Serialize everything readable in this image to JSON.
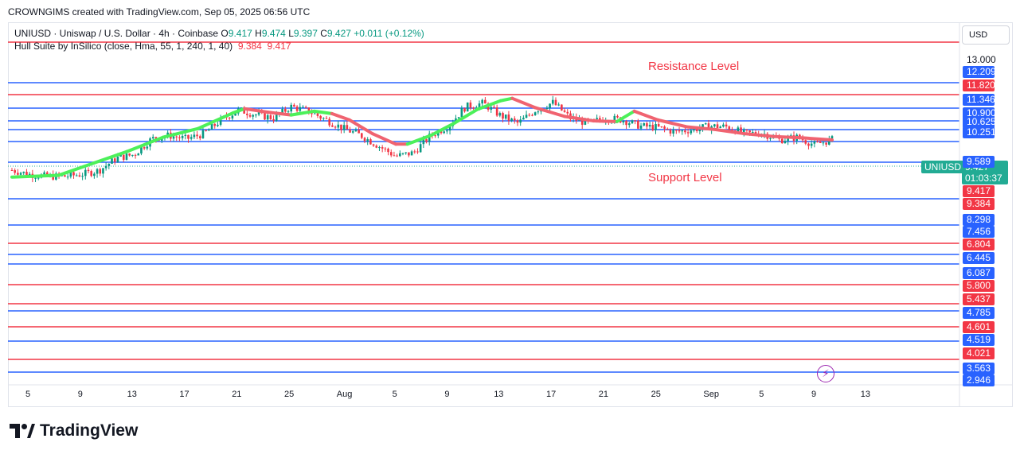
{
  "header": {
    "caption": "CROWNGIMS created with TradingView.com, Sep 05, 2025 06:56 UTC"
  },
  "legend": {
    "symbol_line": "UNIUSD · Uniswap / U.S. Dollar · 4h · Coinbase",
    "o_label": "O",
    "o_value": "9.417",
    "h_label": "H",
    "h_value": "9.474",
    "l_label": "L",
    "l_value": "9.397",
    "c_label": "C",
    "c_value": "9.427",
    "change": "+0.011 (+0.12%)",
    "indicator_line": "Hull Suite by InSilico (close, Hma, 55, 1, 240, 1, 40)",
    "ind_value_1": "9.384",
    "ind_value_2": "9.417"
  },
  "currency_button": "USD",
  "annotations": {
    "resistance": "Resistance Level",
    "support": "Support Level"
  },
  "symbol_tag": "UNIUSD",
  "last_price": {
    "value": "9.427",
    "countdown": "01:03:37"
  },
  "branding": {
    "logo_text": "TradingView"
  },
  "colors": {
    "up": "#089981",
    "down": "#f23645",
    "blue_level": "#2962ff",
    "red_level": "#f23645",
    "hull_up": "#4cf05a",
    "hull_down": "#f06370"
  },
  "chart_data": {
    "type": "candlestick",
    "ylim": [
      2.946,
      13.0
    ],
    "top_tick": "13.000",
    "price_levels": [
      {
        "value": 12.209,
        "label": "12.209",
        "color": "blue"
      },
      {
        "value": 11.82,
        "label": "11.820",
        "color": "red"
      },
      {
        "value": 11.346,
        "label": "11.346",
        "color": "blue"
      },
      {
        "value": 10.9,
        "label": "10.900",
        "color": "blue"
      },
      {
        "value": 10.625,
        "label": "10.625",
        "color": "blue"
      },
      {
        "value": 10.251,
        "label": "10.251",
        "color": "blue"
      },
      {
        "value": 9.589,
        "label": "9.589",
        "color": "blue"
      },
      {
        "value": 9.417,
        "label": "9.417",
        "color": "red-badge"
      },
      {
        "value": 9.384,
        "label": "9.384",
        "color": "red-badge"
      },
      {
        "value": 8.298,
        "label": "8.298",
        "color": "blue"
      },
      {
        "value": 7.456,
        "label": "7.456",
        "color": "blue"
      },
      {
        "value": 6.804,
        "label": "6.804",
        "color": "red"
      },
      {
        "value": 6.445,
        "label": "6.445",
        "color": "blue"
      },
      {
        "value": 6.087,
        "label": "6.087",
        "color": "blue"
      },
      {
        "value": 5.8,
        "label": "5.800",
        "color": "red"
      },
      {
        "value": 5.437,
        "label": "5.437",
        "color": "red"
      },
      {
        "value": 4.785,
        "label": "4.785",
        "color": "blue"
      },
      {
        "value": 4.601,
        "label": "4.601",
        "color": "red"
      },
      {
        "value": 4.519,
        "label": "4.519",
        "color": "blue"
      },
      {
        "value": 4.021,
        "label": "4.021",
        "color": "red"
      },
      {
        "value": 3.563,
        "label": "3.563",
        "color": "blue"
      },
      {
        "value": 2.946,
        "label": "2.946",
        "color": "blue"
      }
    ],
    "x_tick_labels": [
      "5",
      "9",
      "13",
      "17",
      "21",
      "25",
      "Aug",
      "5",
      "9",
      "13",
      "17",
      "21",
      "25",
      "Sep",
      "5",
      "9",
      "13"
    ],
    "price_path": [
      [
        0,
        9.55
      ],
      [
        3,
        9.43
      ],
      [
        6,
        9.37
      ],
      [
        9,
        9.37
      ],
      [
        12,
        9.43
      ],
      [
        15,
        9.54
      ],
      [
        18,
        9.9
      ],
      [
        21,
        10.0
      ],
      [
        24,
        10.45
      ],
      [
        27,
        10.55
      ],
      [
        30,
        10.45
      ],
      [
        33,
        10.6
      ],
      [
        36,
        11.0
      ],
      [
        39,
        11.28
      ],
      [
        42,
        11.15
      ],
      [
        45,
        11.05
      ],
      [
        48,
        11.38
      ],
      [
        51,
        11.25
      ],
      [
        54,
        11.0
      ],
      [
        57,
        10.75
      ],
      [
        60,
        10.55
      ],
      [
        63,
        10.25
      ],
      [
        66,
        9.95
      ],
      [
        69,
        10.05
      ],
      [
        72,
        10.55
      ],
      [
        75,
        10.82
      ],
      [
        78,
        11.38
      ],
      [
        81,
        11.48
      ],
      [
        84,
        11.12
      ],
      [
        87,
        10.9
      ],
      [
        90,
        11.28
      ],
      [
        93,
        11.5
      ],
      [
        96,
        11.05
      ],
      [
        99,
        10.9
      ],
      [
        102,
        11.05
      ],
      [
        105,
        11.0
      ],
      [
        108,
        10.82
      ],
      [
        111,
        10.78
      ],
      [
        114,
        10.65
      ],
      [
        117,
        10.72
      ],
      [
        120,
        10.82
      ],
      [
        123,
        10.8
      ],
      [
        126,
        10.6
      ],
      [
        129,
        10.62
      ],
      [
        132,
        10.42
      ],
      [
        135,
        10.5
      ],
      [
        138,
        10.28
      ],
      [
        141,
        10.43
      ]
    ],
    "hull_path": [
      [
        0,
        9.35,
        "up"
      ],
      [
        8,
        9.4,
        "up"
      ],
      [
        14,
        9.75,
        "up"
      ],
      [
        20,
        10.1,
        "up"
      ],
      [
        26,
        10.5,
        "up"
      ],
      [
        32,
        10.75,
        "up"
      ],
      [
        38,
        11.2,
        "up"
      ],
      [
        40,
        11.32,
        "down"
      ],
      [
        44,
        11.22,
        "down"
      ],
      [
        48,
        11.14,
        "up"
      ],
      [
        52,
        11.25,
        "up"
      ],
      [
        55,
        11.18,
        "down"
      ],
      [
        58,
        11.0,
        "down"
      ],
      [
        62,
        10.6,
        "down"
      ],
      [
        66,
        10.3,
        "down"
      ],
      [
        68,
        10.3,
        "up"
      ],
      [
        72,
        10.55,
        "up"
      ],
      [
        76,
        10.9,
        "up"
      ],
      [
        80,
        11.3,
        "up"
      ],
      [
        84,
        11.55,
        "up"
      ],
      [
        86,
        11.62,
        "down"
      ],
      [
        90,
        11.35,
        "down"
      ],
      [
        95,
        11.1,
        "down"
      ],
      [
        100,
        10.97,
        "down"
      ],
      [
        104,
        10.95,
        "up"
      ],
      [
        107,
        11.25,
        "down"
      ],
      [
        111,
        11.0,
        "down"
      ],
      [
        116,
        10.8,
        "down"
      ],
      [
        121,
        10.72,
        "down"
      ],
      [
        126,
        10.6,
        "down"
      ],
      [
        131,
        10.52,
        "down"
      ],
      [
        136,
        10.48,
        "down"
      ],
      [
        141,
        10.42,
        "down"
      ]
    ]
  }
}
